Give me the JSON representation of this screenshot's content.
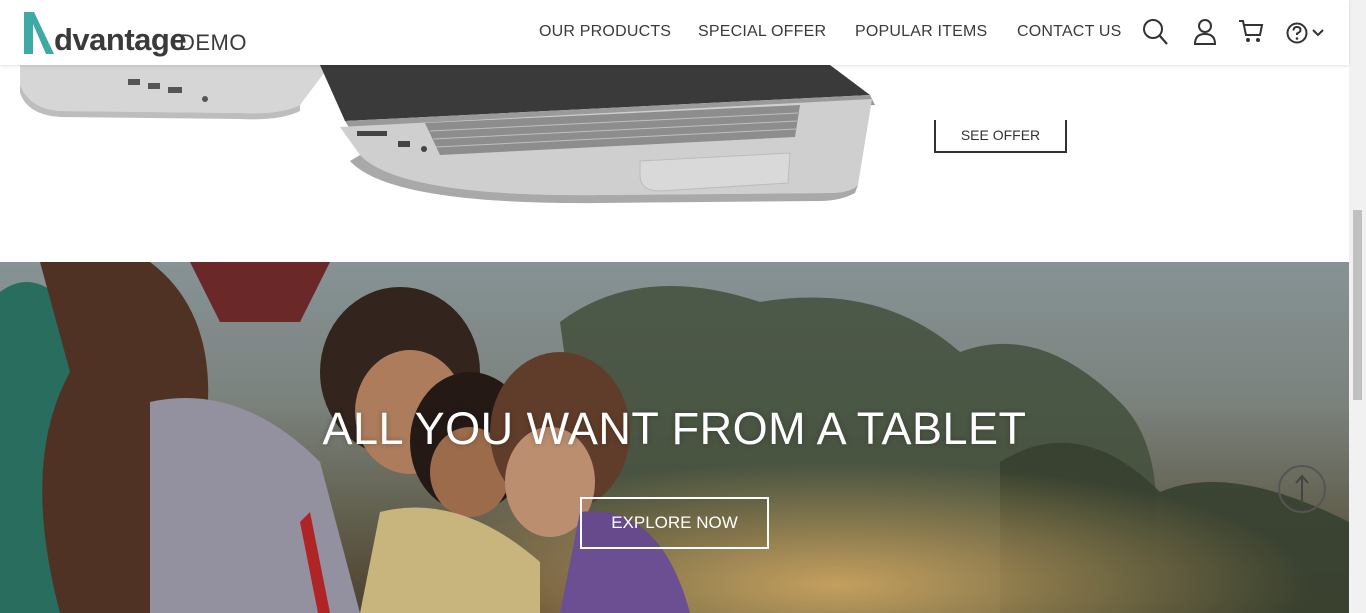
{
  "header": {
    "logo": {
      "main": "dvantage",
      "sub": "DEMO"
    },
    "nav": [
      {
        "label": "OUR PRODUCTS"
      },
      {
        "label": "SPECIAL OFFER"
      },
      {
        "label": "POPULAR ITEMS"
      },
      {
        "label": "CONTACT US"
      }
    ],
    "icons": [
      "search-icon",
      "user-icon",
      "cart-icon",
      "help-icon",
      "chevron-down-icon"
    ]
  },
  "offer": {
    "button_label": "SEE OFFER"
  },
  "hero": {
    "title": "ALL YOU WANT FROM A TABLET",
    "button_label": "EXPLORE NOW"
  },
  "colors": {
    "logo_accent": "#3ea9a5",
    "text": "#3a3a3a"
  }
}
